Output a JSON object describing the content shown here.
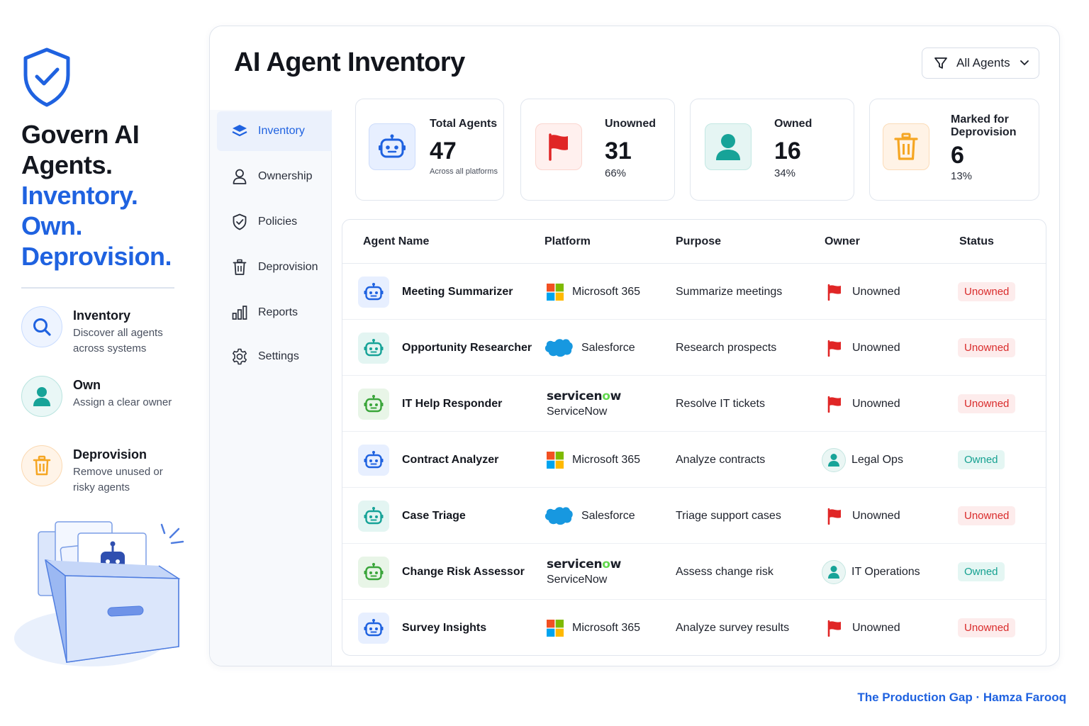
{
  "hero": {
    "title_line1": "Govern AI",
    "title_line2": "Agents.",
    "title_line3": "Inventory.",
    "title_line4": "Own.",
    "title_line5": "Deprovision.",
    "features": [
      {
        "title": "Inventory",
        "desc": "Discover all agents across systems",
        "icon": "search-icon"
      },
      {
        "title": "Own",
        "desc": "Assign a clear owner",
        "icon": "user-icon"
      },
      {
        "title": "Deprovision",
        "desc": "Remove unused or risky agents",
        "icon": "trash-icon"
      }
    ]
  },
  "panel": {
    "title": "AI Agent Inventory",
    "filter_label": "All Agents"
  },
  "sidebar": {
    "items": [
      {
        "label": "Inventory",
        "icon": "layers-icon",
        "active": true
      },
      {
        "label": "Ownership",
        "icon": "user-icon"
      },
      {
        "label": "Policies",
        "icon": "shield-check-icon"
      },
      {
        "label": "Deprovision",
        "icon": "trash-icon"
      },
      {
        "label": "Reports",
        "icon": "bar-chart-icon"
      },
      {
        "label": "Settings",
        "icon": "gear-icon"
      }
    ]
  },
  "stats": [
    {
      "label": "Total Agents",
      "value": "47",
      "sub": "Across all platforms",
      "icon": "robot-icon"
    },
    {
      "label": "Unowned",
      "value": "31",
      "sub": "66%",
      "icon": "flag-icon"
    },
    {
      "label": "Owned",
      "value": "16",
      "sub": "34%",
      "icon": "user-icon"
    },
    {
      "label": "Marked for Deprovision",
      "value": "6",
      "sub": "13%",
      "icon": "trash-icon"
    }
  ],
  "table": {
    "headers": [
      "Agent Name",
      "Platform",
      "Purpose",
      "Owner",
      "Status"
    ],
    "rows": [
      {
        "name": "Meeting Summarizer",
        "platform": "Microsoft 365",
        "purpose": "Summarize meetings",
        "owner": "Unowned",
        "status": "Unowned"
      },
      {
        "name": "Opportunity Researcher",
        "platform": "Salesforce",
        "purpose": "Research prospects",
        "owner": "Unowned",
        "status": "Unowned"
      },
      {
        "name": "IT Help Responder",
        "platform": "ServiceNow",
        "platform_logo": "servicenow",
        "purpose": "Resolve IT tickets",
        "owner": "Unowned",
        "status": "Unowned"
      },
      {
        "name": "Contract Analyzer",
        "platform": "Microsoft 365",
        "purpose": "Analyze contracts",
        "owner": "Legal Ops",
        "status": "Owned"
      },
      {
        "name": "Case Triage",
        "platform": "Salesforce",
        "purpose": "Triage support cases",
        "owner": "Unowned",
        "status": "Unowned"
      },
      {
        "name": "Change Risk Assessor",
        "platform": "ServiceNow",
        "platform_logo": "servicenow",
        "purpose": "Assess change risk",
        "owner": "IT Operations",
        "status": "Owned"
      },
      {
        "name": "Survey Insights",
        "platform": "Microsoft 365",
        "purpose": "Analyze survey results",
        "owner": "Unowned",
        "status": "Unowned"
      }
    ]
  },
  "footer": "The Production Gap · Hamza Farooq",
  "colors": {
    "accent": "#1f62e0",
    "unowned": "#d92b2b",
    "owned": "#15a191",
    "teal": "#17a398",
    "orange": "#f5a623"
  }
}
